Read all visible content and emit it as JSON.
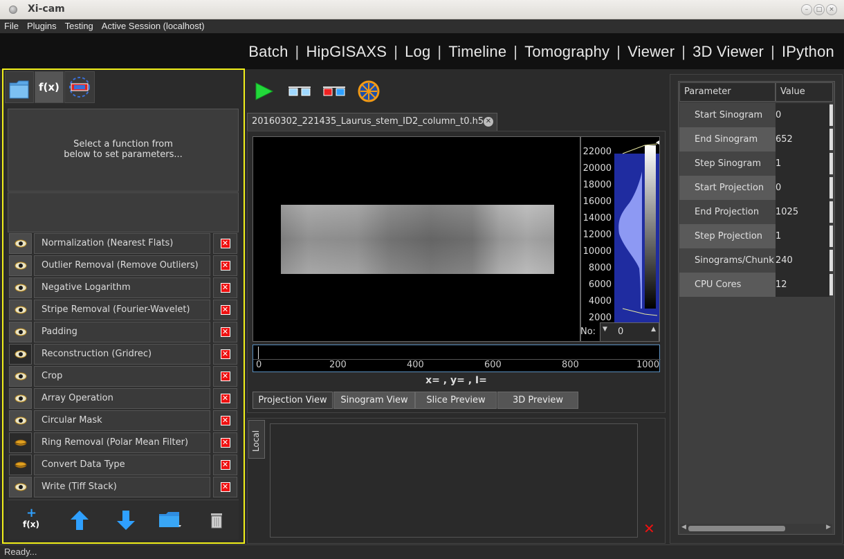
{
  "window": {
    "title": "Xi-cam"
  },
  "menu": [
    "File",
    "Plugins",
    "Testing",
    "Active Session (localhost)"
  ],
  "plugins": [
    "Batch",
    "HipGISAXS",
    "Log",
    "Timeline",
    "Tomography",
    "Viewer",
    "3D Viewer",
    "IPython"
  ],
  "left_panel": {
    "tabs": [
      {
        "icon": "folder-icon"
      },
      {
        "label": "f(x)"
      },
      {
        "icon": "reconstruction-icon"
      }
    ],
    "info_text": "Select a function from\nbelow to set parameters...",
    "functions": [
      {
        "label": "Normalization (Nearest Flats)",
        "preview_icon": "eye-icon",
        "active": true
      },
      {
        "label": "Outlier Removal (Remove Outliers)",
        "preview_icon": "eye-icon",
        "active": true
      },
      {
        "label": "Negative Logarithm",
        "preview_icon": "eye-icon",
        "active": true
      },
      {
        "label": "Stripe Removal (Fourier-Wavelet)",
        "preview_icon": "eye-icon",
        "active": true
      },
      {
        "label": "Padding",
        "preview_icon": "eye-icon",
        "active": true
      },
      {
        "label": "Reconstruction (Gridrec)",
        "preview_icon": "eye-icon",
        "active": false
      },
      {
        "label": "Crop",
        "preview_icon": "eye-icon",
        "active": true
      },
      {
        "label": "Array Operation",
        "preview_icon": "eye-icon",
        "active": true
      },
      {
        "label": "Circular Mask",
        "preview_icon": "eye-icon",
        "active": true
      },
      {
        "label": "Ring Removal (Polar Mean Filter)",
        "preview_icon": "closed-eye-icon",
        "active": false
      },
      {
        "label": "Convert Data Type",
        "preview_icon": "closed-eye-icon",
        "active": false
      },
      {
        "label": "Write (Tiff Stack)",
        "preview_icon": "eye-icon",
        "active": true
      }
    ],
    "bottom_buttons": [
      {
        "label": "f(x)",
        "icon": "add-function-icon"
      },
      {
        "icon": "move-up-icon"
      },
      {
        "icon": "move-down-icon"
      },
      {
        "icon": "open-folder-icon"
      },
      {
        "icon": "trash-icon"
      }
    ]
  },
  "center": {
    "toolbar": [
      "run-icon",
      "preview-icon",
      "3d-preview-icon",
      "center-detection-icon"
    ],
    "file_tab": "20160302_221435_Laurus_stem_ID2_column_t0.h5",
    "histogram_ticks": [
      "22000",
      "20000",
      "18000",
      "16000",
      "14000",
      "12000",
      "10000",
      "8000",
      "6000",
      "4000",
      "2000"
    ],
    "no_label": "No:",
    "no_value": "0",
    "timeline_ticks": [
      "0",
      "200",
      "400",
      "600",
      "800",
      "1000"
    ],
    "coords_text": "x= , y= , I=",
    "view_tabs": [
      "Projection View",
      "Sinogram View",
      "Slice Preview",
      "3D Preview"
    ],
    "console_tab": "Local"
  },
  "right_panel": {
    "headers": [
      "Parameter",
      "Value"
    ],
    "rows": [
      {
        "name": "Start Sinogram",
        "value": "0"
      },
      {
        "name": "End Sinogram",
        "value": "652"
      },
      {
        "name": "Step Sinogram",
        "value": "1"
      },
      {
        "name": "Start Projection",
        "value": "0"
      },
      {
        "name": "End Projection",
        "value": "1025"
      },
      {
        "name": "Step Projection",
        "value": "1"
      },
      {
        "name": "Sinograms/Chunk",
        "value": "240"
      },
      {
        "name": "CPU Cores",
        "value": "12"
      }
    ]
  },
  "status": "Ready..."
}
